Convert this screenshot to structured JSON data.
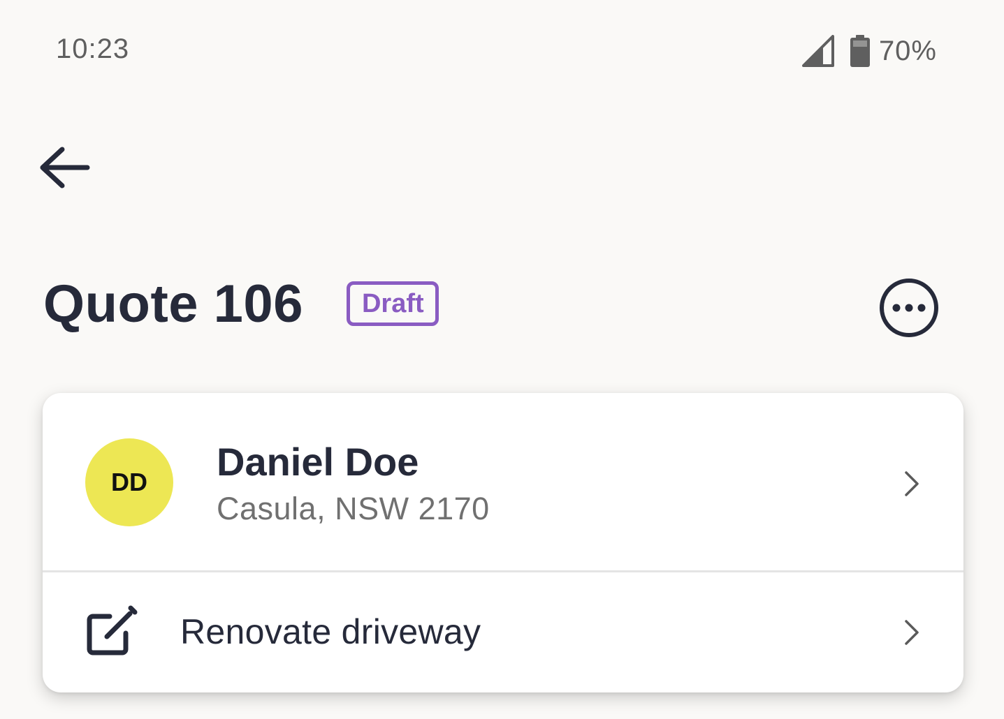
{
  "status_bar": {
    "time": "10:23",
    "battery": "70%",
    "icons": [
      "signal-icon",
      "battery-icon"
    ]
  },
  "header": {
    "back_icon": "arrow-left-icon",
    "title": "Quote 106",
    "status": "Draft",
    "more_icon": "more-horizontal-circle-icon"
  },
  "client": {
    "initials": "DD",
    "name": "Daniel Doe",
    "address": "Casula, NSW 2170",
    "chevron_icon": "chevron-right-icon"
  },
  "job": {
    "icon": "edit-icon",
    "title": "Renovate driveway",
    "chevron_icon": "chevron-right-icon"
  },
  "colors": {
    "background": "#faf9f7",
    "text_primary": "#262a3a",
    "text_secondary": "#707070",
    "badge": "#8a5cc2",
    "avatar": "#ede754"
  }
}
